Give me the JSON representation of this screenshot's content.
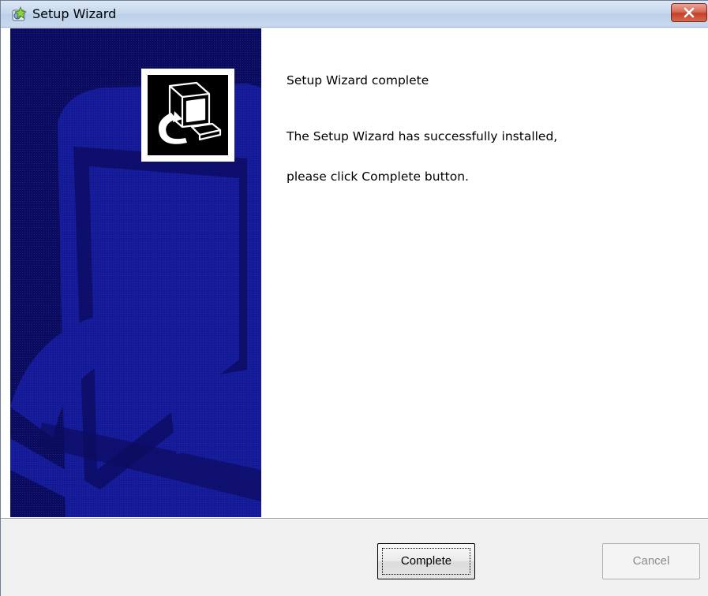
{
  "window": {
    "title": "Setup Wizard",
    "title_icon": "setup-wizard-icon",
    "close_icon": "close-x-icon"
  },
  "main": {
    "heading": "Setup Wizard complete",
    "line1": "The Setup Wizard has successfully installed,",
    "line2": "please click Complete button."
  },
  "side_panel": {
    "logo_icon": "installer-computer-icon",
    "background_color": "#0b0b5e"
  },
  "buttons": {
    "complete_label": "Complete",
    "cancel_label": "Cancel",
    "cancel_enabled": false
  },
  "colors": {
    "close_button": "#c3412a",
    "panel_dark": "#0b0b5e",
    "panel_mid": "#141a96"
  }
}
